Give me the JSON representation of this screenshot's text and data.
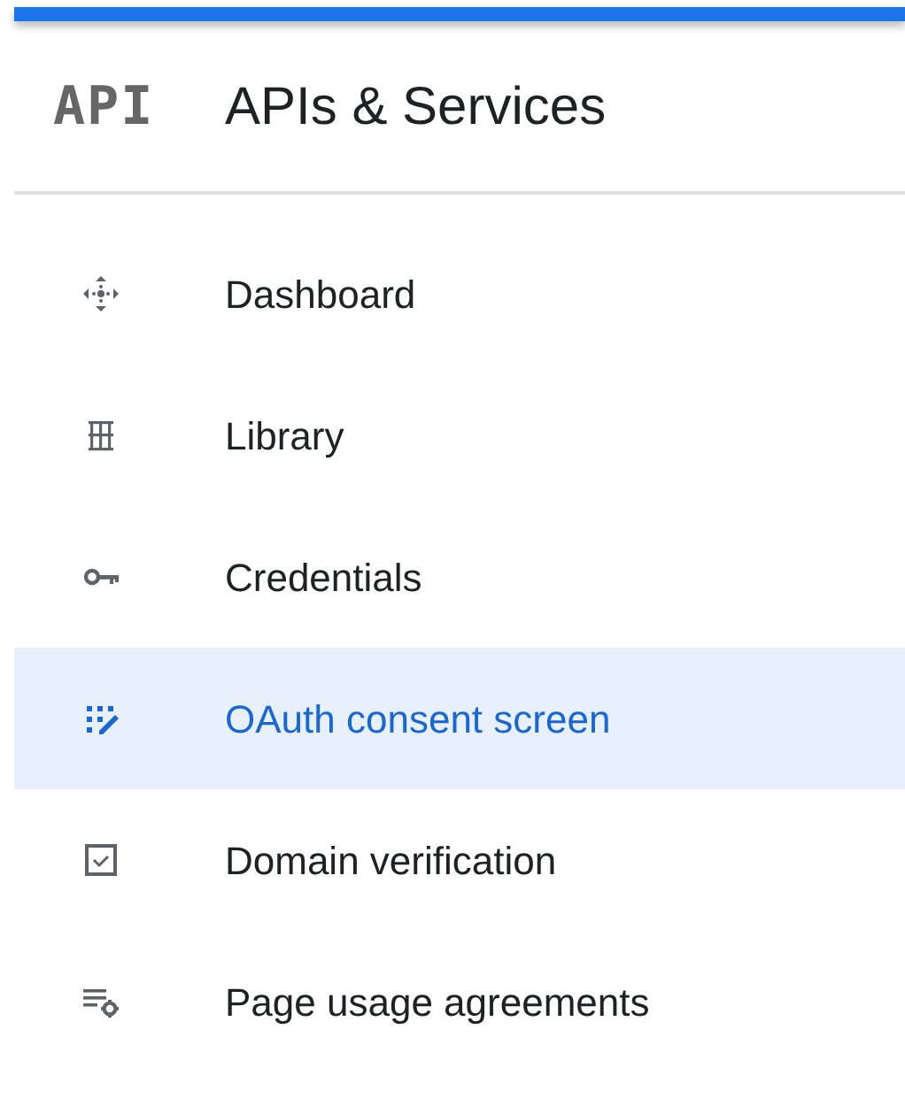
{
  "header": {
    "logo": "API",
    "title": "APIs & Services"
  },
  "nav_items": [
    {
      "label": "Dashboard",
      "selected": false
    },
    {
      "label": "Library",
      "selected": false
    },
    {
      "label": "Credentials",
      "selected": false
    },
    {
      "label": "OAuth consent screen",
      "selected": true
    },
    {
      "label": "Domain verification",
      "selected": false
    },
    {
      "label": "Page usage agreements",
      "selected": false
    }
  ]
}
